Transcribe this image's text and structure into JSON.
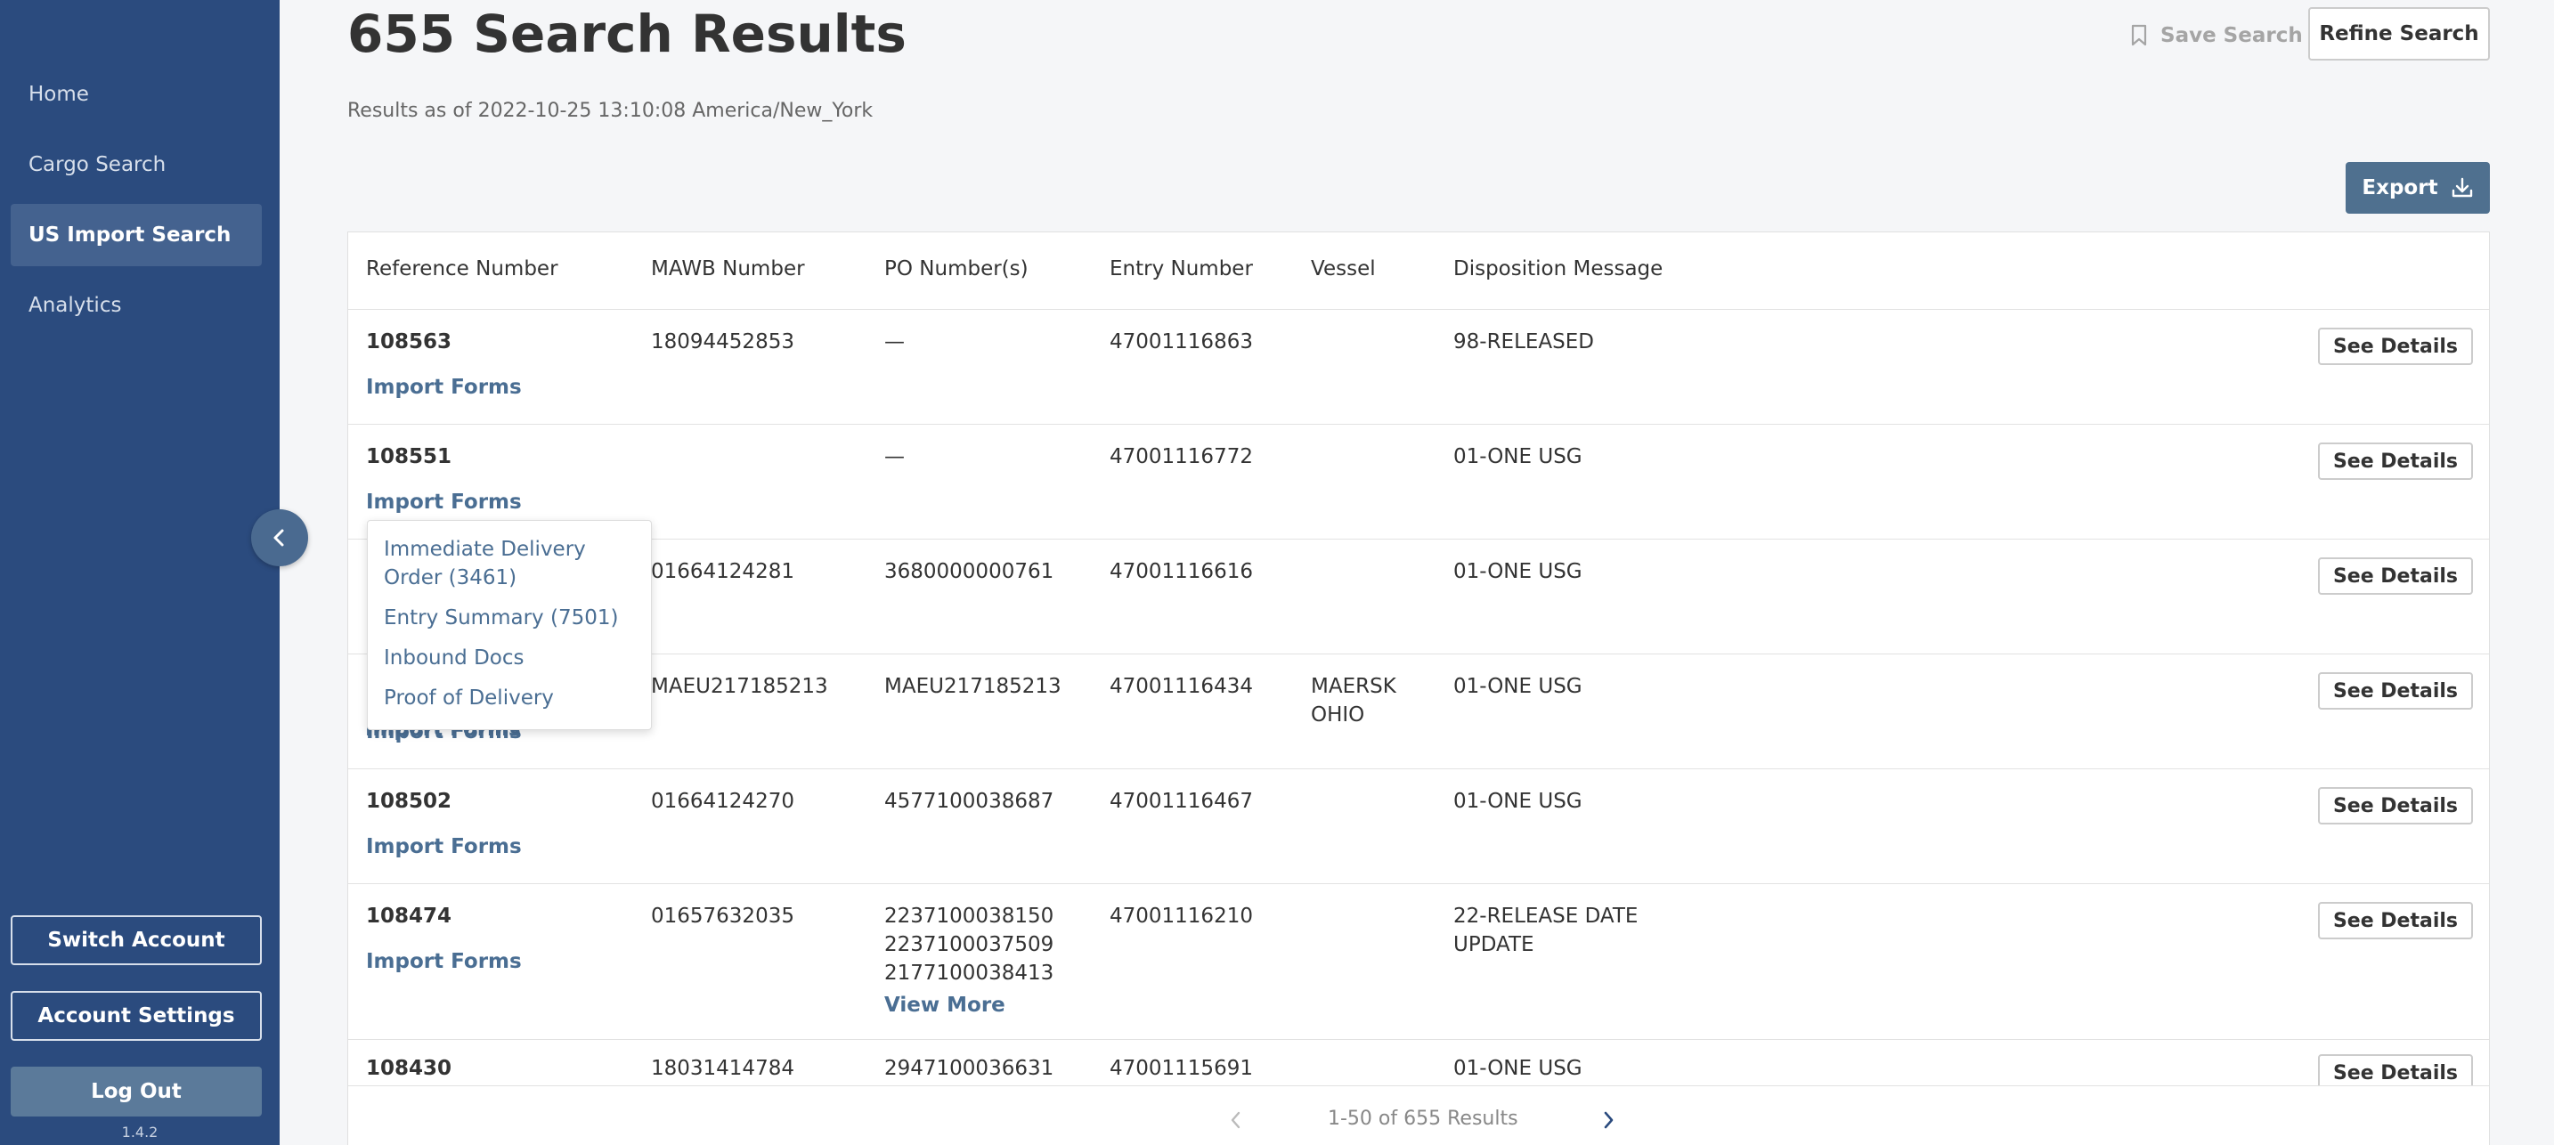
{
  "sidebar": {
    "items": [
      {
        "label": "Home"
      },
      {
        "label": "Cargo Search"
      },
      {
        "label": "US Import Search"
      },
      {
        "label": "Analytics"
      }
    ],
    "switch_account": "Switch Account",
    "account_settings": "Account Settings",
    "log_out": "Log Out",
    "version": "1.4.2"
  },
  "header": {
    "title": "655 Search Results",
    "results_as_of": "Results as of 2022-10-25 13:10:08 America/New_York",
    "save_search": "Save Search",
    "refine_search": "Refine Search",
    "export": "Export"
  },
  "table": {
    "columns": [
      "Reference Number",
      "MAWB Number",
      "PO Number(s)",
      "Entry Number",
      "Vessel",
      "Disposition Message"
    ],
    "import_forms_label": "Import Forms",
    "see_details_label": "See Details",
    "view_more_label": "View More",
    "rows": [
      {
        "ref": "108563",
        "mawb": "18094452853",
        "po": [
          "—"
        ],
        "entry": "47001116863",
        "vessel": "",
        "disposition": "98-RELEASED"
      },
      {
        "ref": "108551",
        "mawb": "",
        "po": [
          "—"
        ],
        "entry": "47001116772",
        "vessel": "",
        "disposition": "01-ONE USG"
      },
      {
        "ref": "",
        "mawb": "01664124281",
        "po": [
          "3680000000761"
        ],
        "entry": "47001116616",
        "vessel": "",
        "disposition": "01-ONE USG"
      },
      {
        "ref": "",
        "mawb": "MAEU217185213",
        "po": [
          "MAEU217185213"
        ],
        "entry": "47001116434",
        "vessel": "MAERSK OHIO",
        "disposition": "01-ONE USG"
      },
      {
        "ref": "108502",
        "mawb": "01664124270",
        "po": [
          "4577100038687"
        ],
        "entry": "47001116467",
        "vessel": "",
        "disposition": "01-ONE USG"
      },
      {
        "ref": "108474",
        "mawb": "01657632035",
        "po": [
          "2237100038150",
          "2237100037509",
          "2177100038413"
        ],
        "entry": "47001116210",
        "vessel": "",
        "disposition": "22-RELEASE DATE UPDATE"
      },
      {
        "ref": "108430",
        "mawb": "18031414784",
        "po": [
          "2947100036631"
        ],
        "entry": "47001115691",
        "vessel": "",
        "disposition": "01-ONE USG"
      }
    ]
  },
  "dropdown": {
    "items": [
      "Immediate Delivery Order (3461)",
      "Entry Summary (7501)",
      "Inbound Docs",
      "Proof of Delivery"
    ]
  },
  "pagination": {
    "text": "1-50 of 655 Results"
  },
  "colors": {
    "sidebar_bg": "#2b4b7e",
    "sidebar_active": "#44628f",
    "link": "#4a6e93",
    "export_bg": "#4f708f"
  }
}
